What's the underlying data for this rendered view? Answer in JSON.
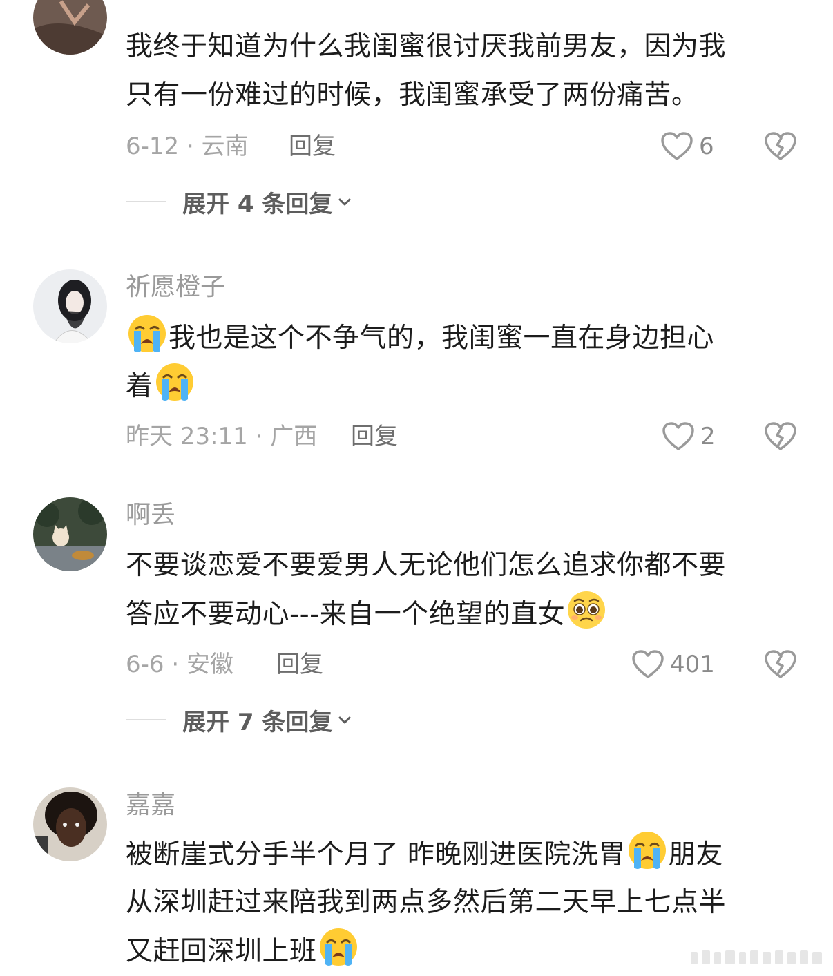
{
  "comments": [
    {
      "username": "",
      "lines": [
        "我终于知道为什么我闺蜜很讨厌我前男友，因为我",
        "只有一份难过的时候，我闺蜜承受了两份痛苦。"
      ],
      "meta": "6-12 · 云南",
      "reply_label": "回复",
      "likes": "6",
      "expand_label": "展开 4 条回复"
    },
    {
      "username": "祈愿橙子",
      "line1_after_emoji": "我也是这个不争气的，我闺蜜一直在身边担心",
      "line2_before_emoji": "着",
      "meta": "昨天 23:11 · 广西",
      "reply_label": "回复",
      "likes": "2"
    },
    {
      "username": "啊丢",
      "lines": [
        "不要谈恋爱不要爱男人无论他们怎么追求你都不要"
      ],
      "line2_before_emoji": "答应不要动心---来自一个绝望的直女",
      "meta": "6-6 · 安徽",
      "reply_label": "回复",
      "likes": "401",
      "expand_label": "展开 7 条回复"
    },
    {
      "username": "嘉嘉",
      "line1_before_emoji": "被断崖式分手半个月了 昨晚刚进医院洗胃",
      "line1_after_emoji": "朋友",
      "line2": "从深圳赶过来陪我到两点多然后第二天早上七点半",
      "line3_before_emoji": "又赶回深圳上班"
    }
  ],
  "icons": {
    "like": "heart-outline-icon",
    "dislike": "broken-heart-icon",
    "expand": "chevron-down-icon",
    "emoji_crying": "loudly-crying-face-emoji",
    "emoji_pleading": "pleading-face-emoji"
  },
  "colors": {
    "username": "#9a9a9a",
    "meta": "#a5a5a5",
    "reply": "#6e6e6e",
    "icon": "#9a9a9a",
    "emoji_yellow": "#ffcc33",
    "emoji_tears": "#4fb3f5"
  }
}
